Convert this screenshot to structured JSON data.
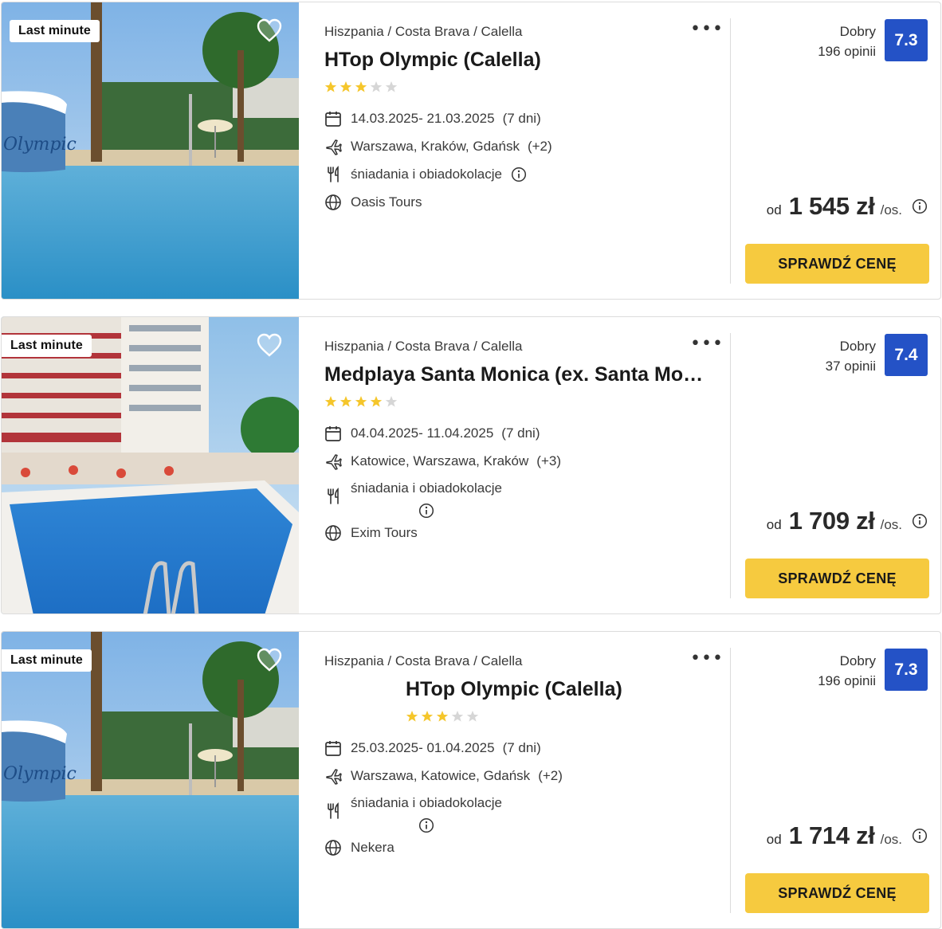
{
  "offers": [
    {
      "badge": "Last minute",
      "breadcrumb": "Hiszpania / Costa Brava / Calella",
      "title": "HTop Olympic (Calella)",
      "stars": 3,
      "dates": "14.03.2025- 21.03.2025",
      "nights": "(7 dni)",
      "airports": "Warszawa, Kraków, Gdańsk",
      "airports_more": "(+2)",
      "meal": "śniadania i obiadokolacje",
      "operator": "Oasis Tours",
      "rating_label": "Dobry",
      "reviews": "196 opinii",
      "score": "7.3",
      "price_prefix": "od",
      "price": "1 545 zł",
      "price_suffix": "/os.",
      "cta": "SPRAWDŹ CENĘ"
    },
    {
      "badge": "Last minute",
      "breadcrumb": "Hiszpania / Costa Brava / Calella",
      "title": "Medplaya Santa Monica (ex. Santa Monica)",
      "stars": 4,
      "dates": "04.04.2025- 11.04.2025",
      "nights": "(7 dni)",
      "airports": "Katowice, Warszawa, Kraków",
      "airports_more": "(+3)",
      "meal": "śniadania i obiadokolacje",
      "operator": "Exim Tours",
      "rating_label": "Dobry",
      "reviews": "37 opinii",
      "score": "7.4",
      "price_prefix": "od",
      "price": "1 709 zł",
      "price_suffix": "/os.",
      "cta": "SPRAWDŹ CENĘ"
    },
    {
      "badge": "Last minute",
      "breadcrumb": "Hiszpania / Costa Brava / Calella",
      "title": "HTop Olympic (Calella)",
      "stars": 3,
      "dates": "25.03.2025- 01.04.2025",
      "nights": "(7 dni)",
      "airports": "Warszawa, Katowice, Gdańsk",
      "airports_more": "(+2)",
      "meal": "śniadania i obiadokolacje",
      "operator": "Nekera",
      "rating_label": "Dobry",
      "reviews": "196 opinii",
      "score": "7.3",
      "price_prefix": "od",
      "price": "1 714 zł",
      "price_suffix": "/os.",
      "cta": "SPRAWDŹ CENĘ"
    }
  ],
  "colors": {
    "score_bg": "#2452c6",
    "cta_bg": "#f6ca3f",
    "star_on": "#f5c62b",
    "star_off": "#d6d6d6"
  },
  "icons": {
    "favorite": "heart-icon",
    "more": "more-dots-icon",
    "dates": "calendar-icon",
    "departure": "plane-icon",
    "meal": "cutlery-icon",
    "operator": "globe-icon",
    "info": "info-icon",
    "rating": "star-icon"
  }
}
